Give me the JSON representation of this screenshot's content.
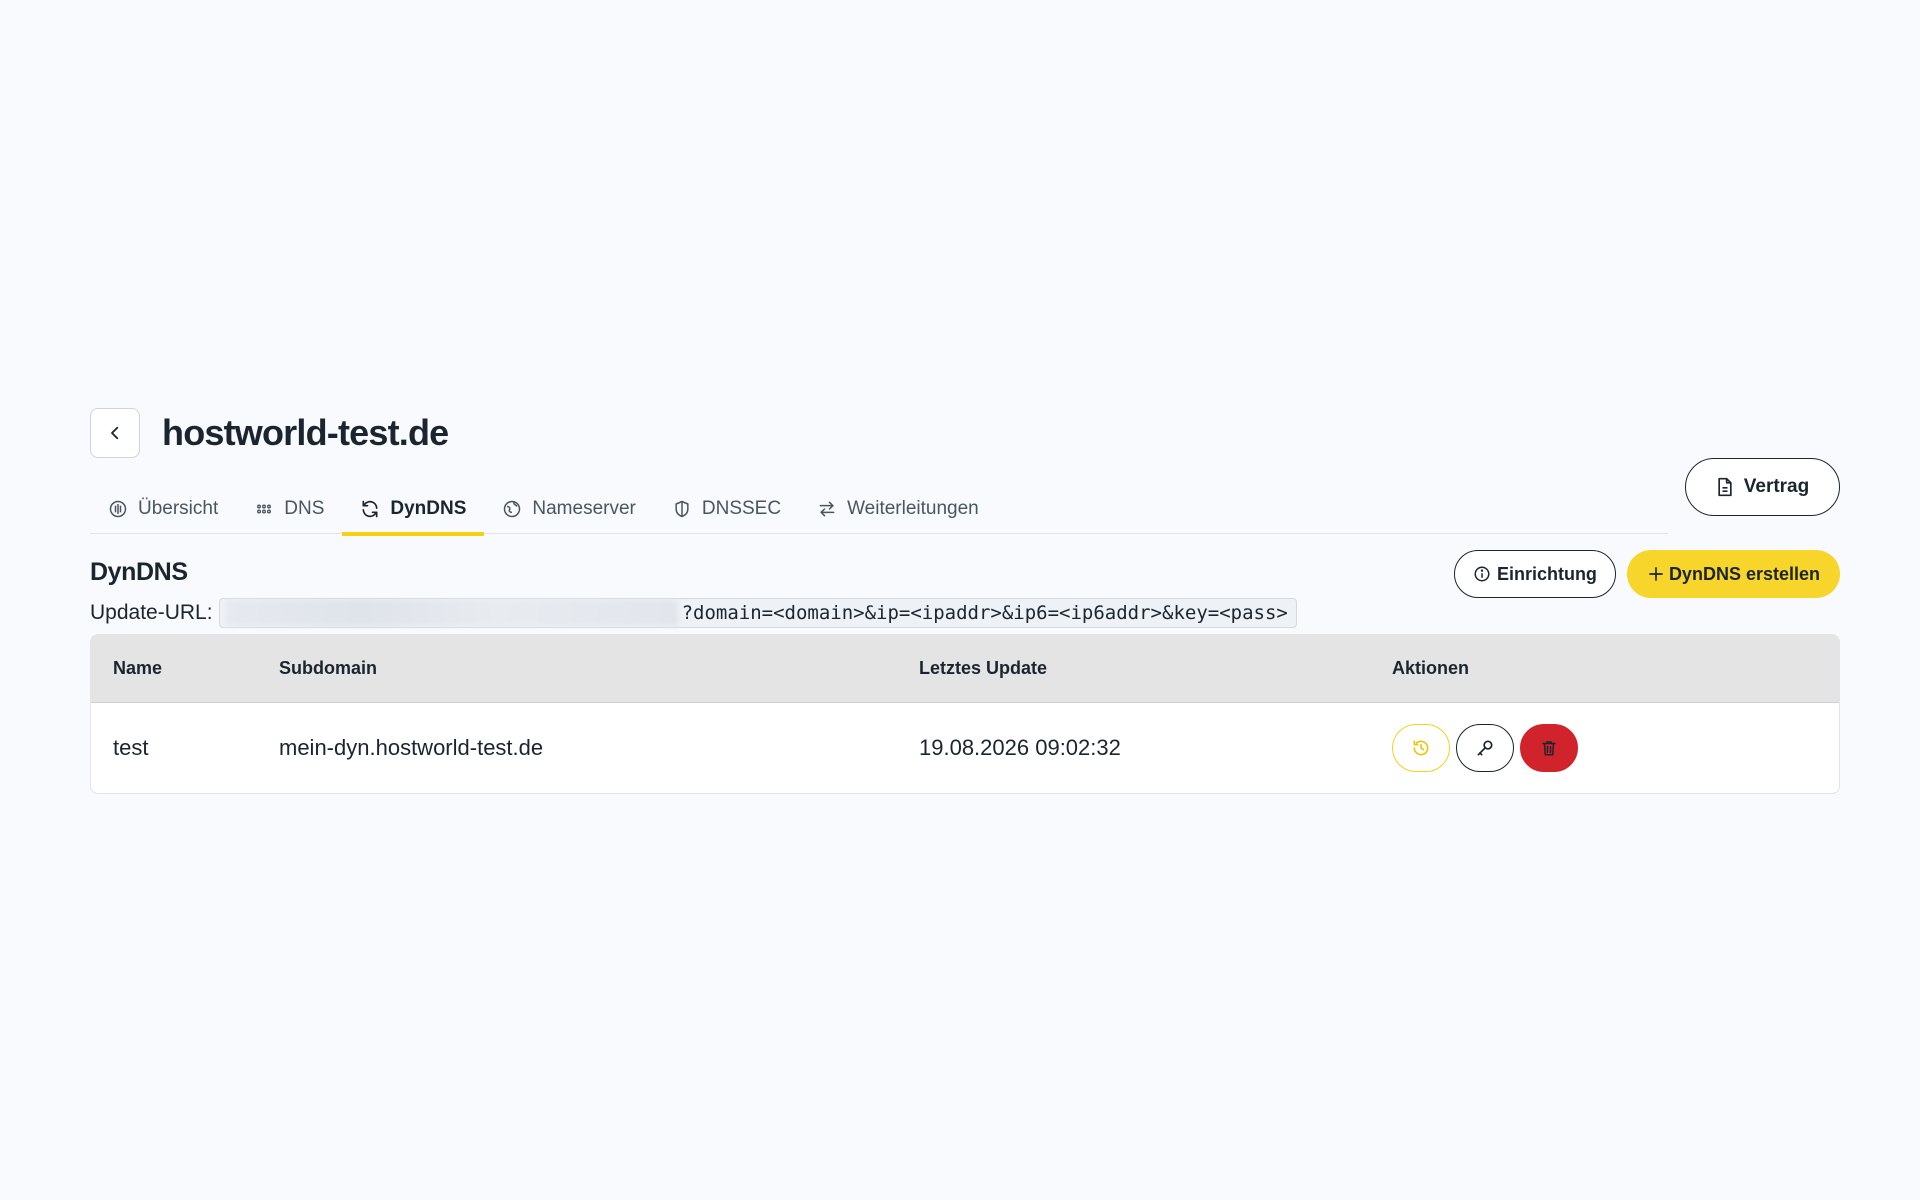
{
  "header": {
    "title": "hostworld-test.de"
  },
  "tabs": [
    {
      "label": "Übersicht",
      "icon": "overview-icon",
      "active": false
    },
    {
      "label": "DNS",
      "icon": "grid-dots-icon",
      "active": false
    },
    {
      "label": "DynDNS",
      "icon": "refresh-icon",
      "active": true
    },
    {
      "label": "Nameserver",
      "icon": "globe-icon",
      "active": false
    },
    {
      "label": "DNSSEC",
      "icon": "shield-icon",
      "active": false
    },
    {
      "label": "Weiterleitungen",
      "icon": "arrows-swap-icon",
      "active": false
    }
  ],
  "contract_button": {
    "label": "Vertrag",
    "icon": "document-icon"
  },
  "section": {
    "title": "DynDNS",
    "update_url_label": "Update-URL:",
    "update_url_query": "?domain=<domain>&ip=<ipaddr>&ip6=<ip6addr>&key=<pass>",
    "setup_button": "Einrichtung",
    "create_button": "DynDNS erstellen"
  },
  "table": {
    "columns": [
      "Name",
      "Subdomain",
      "Letztes Update",
      "Aktionen"
    ],
    "rows": [
      {
        "name": "test",
        "subdomain": "mein-dyn.hostworld-test.de",
        "last_update": "19.08.2026 09:02:32"
      }
    ]
  },
  "colors": {
    "accent": "#f8d52a",
    "danger": "#d0232c",
    "text": "#1b2530",
    "background": "#f8fafd"
  }
}
